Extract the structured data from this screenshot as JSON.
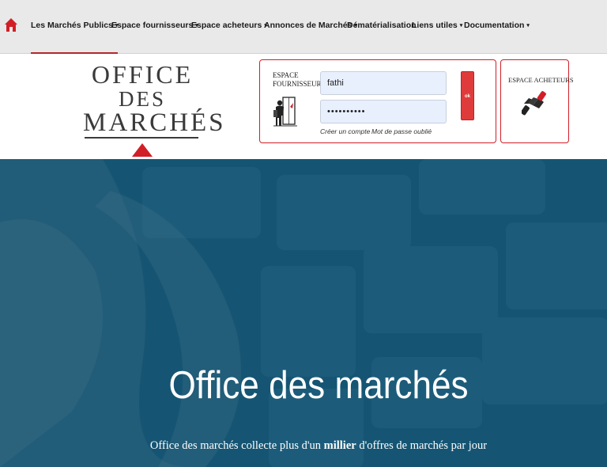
{
  "nav": {
    "home_icon": "home-icon",
    "items": [
      {
        "label": "Les Marchés Publics",
        "caret": "▾",
        "active": true
      },
      {
        "label": "Espace fournisseurs",
        "caret": "▾",
        "active": false
      },
      {
        "label": "Espace acheteurs",
        "caret": "▾",
        "active": false
      },
      {
        "label": "Annonces de Marchés",
        "caret": "▾",
        "active": false
      },
      {
        "label": "Dématérialisation",
        "caret": "",
        "active": false
      },
      {
        "label": "Liens utiles",
        "caret": "▾",
        "active": false
      },
      {
        "label": "Documentation",
        "caret": "▾",
        "active": false
      }
    ]
  },
  "logo": {
    "line1": "OFFICE",
    "line2": "DES",
    "line3": "MARCHÉS"
  },
  "supplier_login": {
    "title_line1": "ESPACE",
    "title_line2": "FOURNISSEURS",
    "icon": "supplier-person-icon",
    "username_value": "fathi",
    "password_value": "••••••••••",
    "ok_label": "ok",
    "create_account": "Créer un compte",
    "forgot_password": "Mot de passe oublié"
  },
  "buyer": {
    "title": "ESPACE ACHETEURS",
    "icon": "handshake-icon"
  },
  "hero": {
    "title": "Office des marchés",
    "subtitle_before": "Office des marchés collecte plus d'un ",
    "subtitle_bold": "millier",
    "subtitle_after": " d'offres de marchés par jour"
  },
  "colors": {
    "accent_red": "#d11f26",
    "nav_bg": "#e9e9e9",
    "hero_bg": "#175877"
  }
}
